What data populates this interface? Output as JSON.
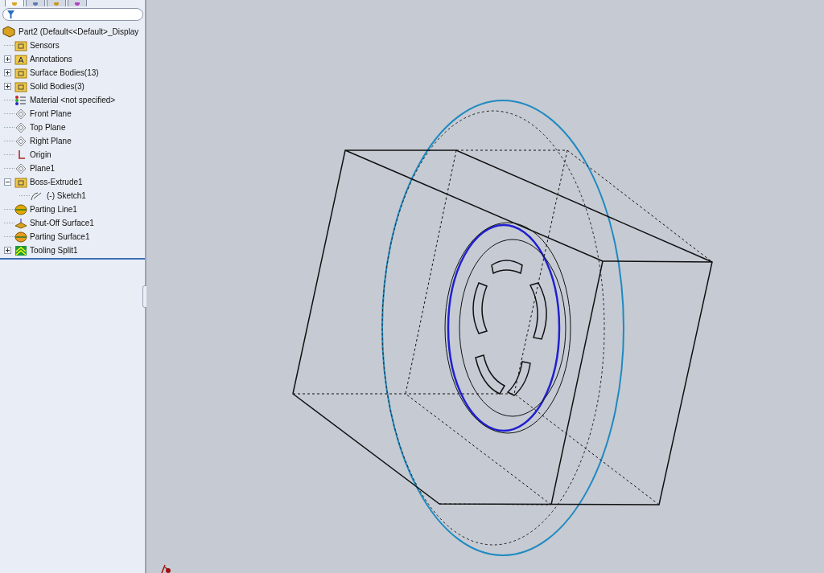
{
  "panel_tabs": [
    {
      "kind": "feature",
      "selected": true
    },
    {
      "kind": "property",
      "selected": false
    },
    {
      "kind": "config",
      "selected": false
    },
    {
      "kind": "display",
      "selected": false
    }
  ],
  "tree": {
    "label": "Part2  (Default<<Default>_Display",
    "kind": "part",
    "children": [
      {
        "label": "Sensors",
        "kind": "sensors"
      },
      {
        "label": "Annotations",
        "kind": "annotations",
        "expanded": false
      },
      {
        "label": "Surface Bodies(13)",
        "kind": "surface-bodies",
        "expanded": false
      },
      {
        "label": "Solid Bodies(3)",
        "kind": "solid-bodies",
        "expanded": false
      },
      {
        "label": "Material <not specified>",
        "kind": "material"
      },
      {
        "label": "Front Plane",
        "kind": "plane"
      },
      {
        "label": "Top Plane",
        "kind": "plane"
      },
      {
        "label": "Right Plane",
        "kind": "plane"
      },
      {
        "label": "Origin",
        "kind": "origin"
      },
      {
        "label": "Plane1",
        "kind": "plane"
      },
      {
        "label": "Boss-Extrude1",
        "kind": "extrude",
        "expanded": true,
        "children": [
          {
            "label": "(-) Sketch1",
            "kind": "sketch"
          }
        ]
      },
      {
        "label": "Parting Line1",
        "kind": "parting-line"
      },
      {
        "label": "Shut-Off Surface1",
        "kind": "shutoff"
      },
      {
        "label": "Parting Surface1",
        "kind": "parting-surface"
      },
      {
        "label": "Tooling Split1",
        "kind": "tooling",
        "expanded": false
      }
    ]
  }
}
